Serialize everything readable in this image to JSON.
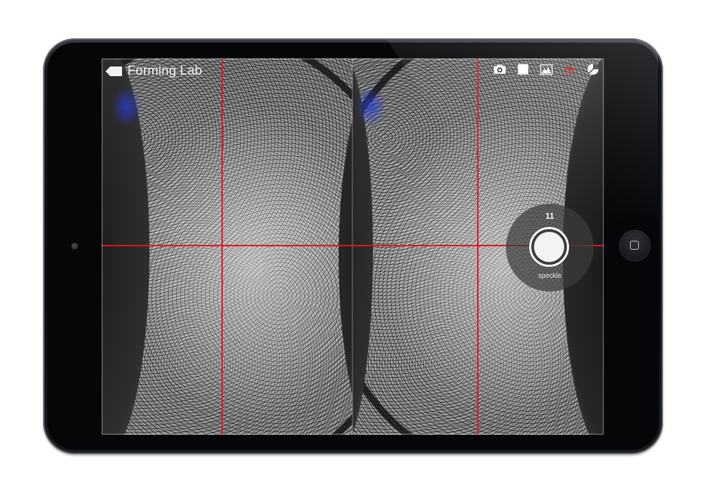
{
  "app": {
    "title": "Forming Lab",
    "back_icon": "back-arrow-icon"
  },
  "toolbar": {
    "items": [
      {
        "name": "camera-icon",
        "color": "#ffffff"
      },
      {
        "name": "white-square-icon",
        "color": "#ffffff"
      },
      {
        "name": "histogram-icon",
        "color": "#ffffff"
      },
      {
        "name": "crosshair-icon",
        "color": "#e0161b"
      },
      {
        "name": "exposure-icon",
        "color": "#ffffff"
      }
    ]
  },
  "hud": {
    "count": "11",
    "label": "speckle"
  },
  "colors": {
    "crosshair": "#e0161b",
    "device_body": "#0b0c0e"
  }
}
